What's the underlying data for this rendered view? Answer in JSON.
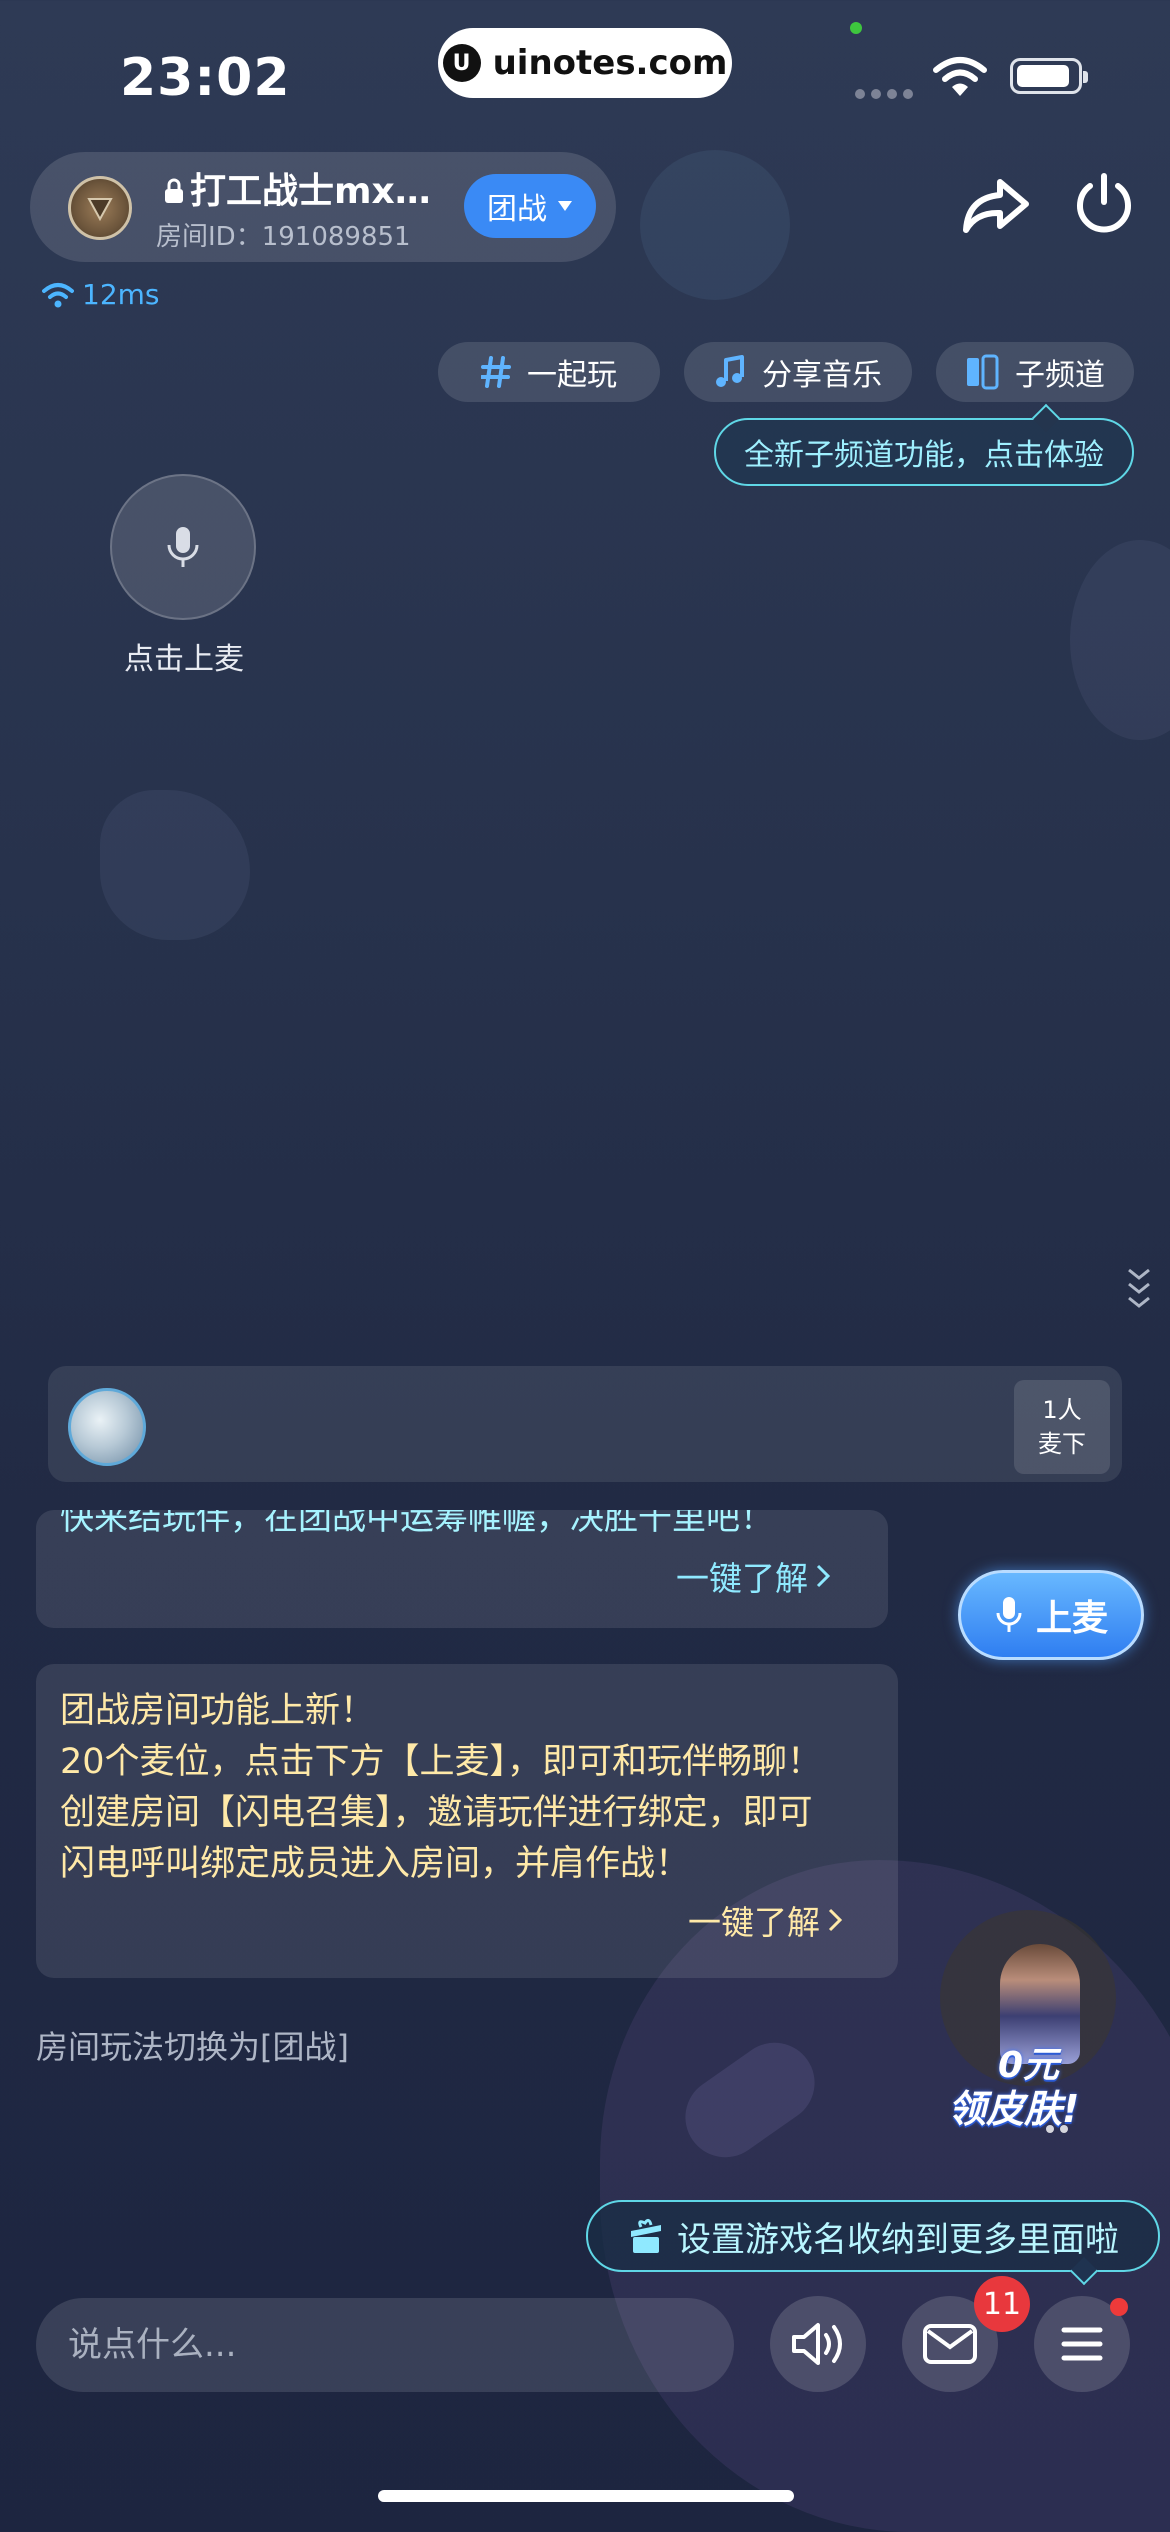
{
  "status_bar": {
    "time": "23:02",
    "brand": "uinotes.com"
  },
  "room": {
    "title": "打工战士mx…",
    "id_label": "房间ID：191089851",
    "mode_label": "团战",
    "latency": "12ms"
  },
  "chips": [
    {
      "label": "一起玩",
      "icon": "hash-icon"
    },
    {
      "label": "分享音乐",
      "icon": "music-note-icon"
    },
    {
      "label": "子频道",
      "icon": "subchannel-icon"
    }
  ],
  "subchannel_tip": "全新子频道功能，点击体验",
  "mic_seat": {
    "label": "点击上麦"
  },
  "members": {
    "offmic_count": "1人",
    "offmic_label": "麦下"
  },
  "chat": {
    "msg1_partial": "快来结玩伴，在团战中运筹帷幄，决胜千里吧！",
    "msg1_learn_more": "一键了解",
    "msg2_lines": [
      "团战房间功能上新！",
      "20个麦位，点击下方【上麦】，即可和玩伴畅聊！",
      "创建房间【闪电召集】，邀请玩伴进行绑定，即可",
      "闪电呼叫绑定成员进入房间，并肩作战！"
    ],
    "msg2_learn_more": "一键了解",
    "system_message": "房间玩法切换为[团战]"
  },
  "mic_up_label": "上麦",
  "promo": {
    "line1": "0元",
    "line2": "领皮肤!"
  },
  "tip_banner": "设置游戏名收纳到更多里面啦",
  "bottom": {
    "input_placeholder": "说点什么...",
    "mail_badge": "11"
  },
  "colors": {
    "accent_blue": "#3a8af5",
    "teal_border": "#5fd7e6",
    "chat_yellow": "#ffe9a8",
    "badge_red": "#e8383d"
  }
}
